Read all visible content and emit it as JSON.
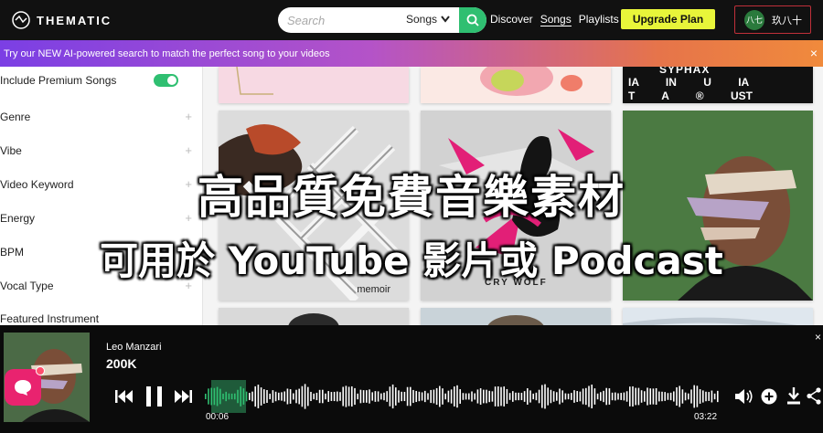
{
  "navbar": {
    "logo_text": "THEMATIC",
    "search_placeholder": "Search",
    "search_scope": "Songs",
    "links": [
      "Discover",
      "Songs",
      "Playlists"
    ],
    "active_link": "Songs",
    "upgrade_label": "Upgrade Plan",
    "user_avatar_text": "八七",
    "user_name": "玖八十"
  },
  "banner": {
    "text": "Try our NEW AI-powered search to match the perfect song to your videos",
    "close": "×"
  },
  "sidebar": {
    "premium_label": "Include Premium Songs",
    "premium_on": true,
    "filters": [
      "Genre",
      "Vibe",
      "Video Keyword",
      "Energy",
      "BPM",
      "Vocal Type",
      "Featured Instrument"
    ],
    "plus": "+"
  },
  "grid": {
    "top_right_text": [
      "SYPHAX",
      "IA IN U IA",
      "T A ® UST"
    ],
    "card_labels": [
      "memoir",
      "CRY WOLF"
    ]
  },
  "overlay": {
    "line1": "高品質免費音樂素材",
    "line2": "可用於 YouTube 影片或 Podcast"
  },
  "player": {
    "artist": "Leo Manzari",
    "plays": "200K",
    "elapsed": "00:06",
    "duration": "03:22",
    "progress": 0.03,
    "close": "×"
  },
  "colors": {
    "accent_green": "#2fbf71",
    "upgrade_yellow": "#e8f53a",
    "chat_pink": "#e9236f"
  },
  "icons": [
    "search-icon",
    "chevron-down-icon",
    "close-icon",
    "previous-icon",
    "pause-icon",
    "next-icon",
    "volume-icon",
    "add-icon",
    "download-icon",
    "share-icon",
    "chat-icon"
  ]
}
